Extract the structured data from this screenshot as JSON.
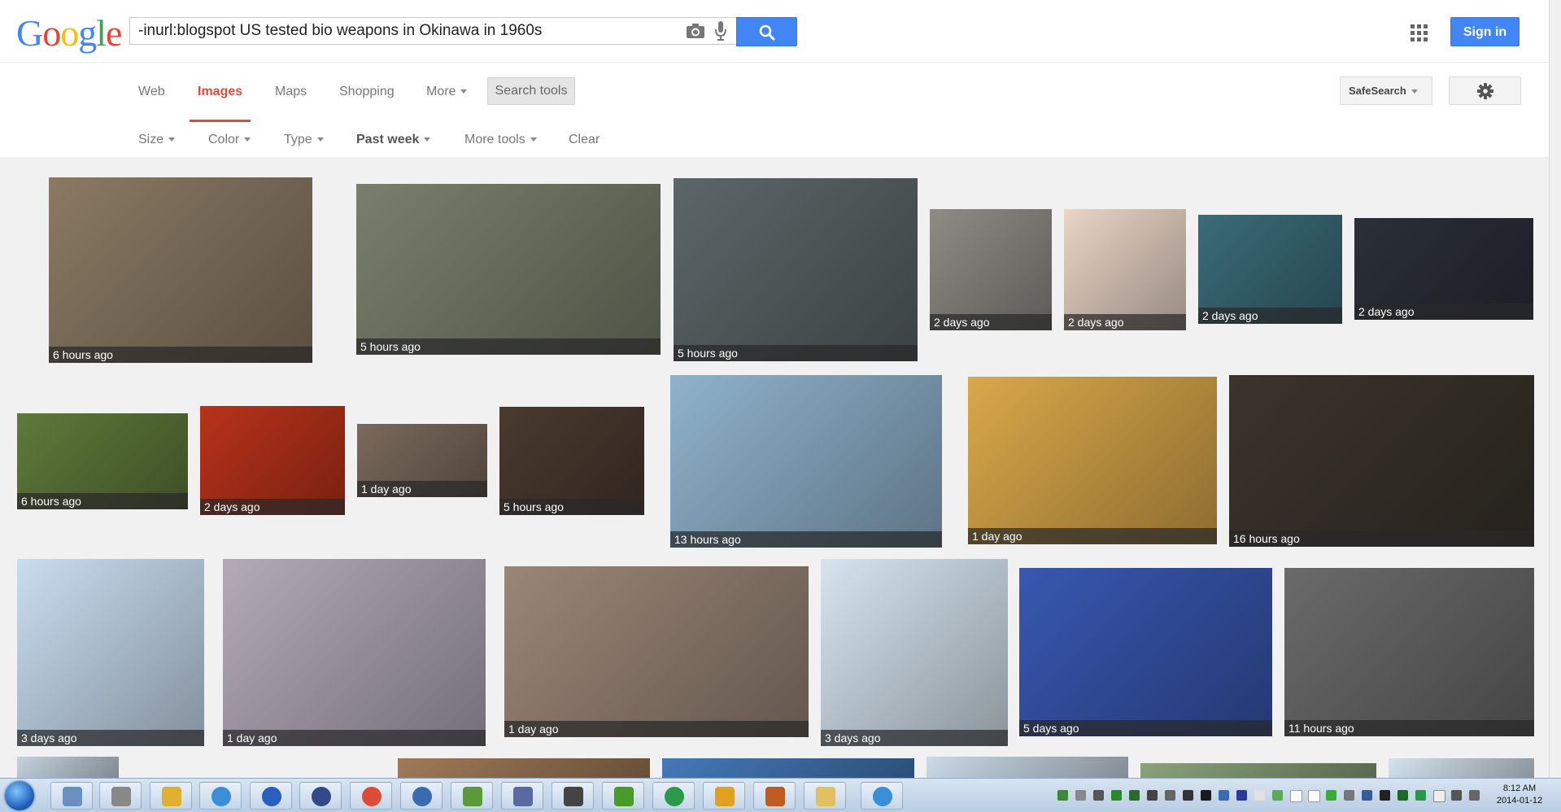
{
  "logo": {
    "letters": [
      {
        "ch": "G",
        "color": "#4285f4"
      },
      {
        "ch": "o",
        "color": "#ea4335"
      },
      {
        "ch": "o",
        "color": "#fbbc05"
      },
      {
        "ch": "g",
        "color": "#4285f4"
      },
      {
        "ch": "l",
        "color": "#34a853"
      },
      {
        "ch": "e",
        "color": "#ea4335"
      }
    ]
  },
  "search": {
    "query": "-inurl:blogspot US tested bio weapons in Okinawa in 1960s"
  },
  "header": {
    "signin_label": "Sign in"
  },
  "tabs": [
    {
      "label": "Web"
    },
    {
      "label": "Images"
    },
    {
      "label": "Maps"
    },
    {
      "label": "Shopping"
    },
    {
      "label": "More"
    }
  ],
  "search_tools_label": "Search tools",
  "safesearch_label": "SafeSearch",
  "tools": [
    {
      "label": "Size"
    },
    {
      "label": "Color"
    },
    {
      "label": "Type"
    },
    {
      "label": "Past week"
    },
    {
      "label": "More tools"
    },
    {
      "label": "Clear"
    }
  ],
  "results": [
    {
      "time": "6 hours ago",
      "color": "#8a7a64"
    },
    {
      "time": "5 hours ago",
      "color": "#7a7f6c"
    },
    {
      "time": "5 hours ago",
      "color": "#5c6668"
    },
    {
      "time": "2 days ago",
      "color": "#8e8c86"
    },
    {
      "time": "2 days ago",
      "color": "#ead5c6"
    },
    {
      "time": "2 days ago",
      "color": "#3a6c78"
    },
    {
      "time": "2 days ago",
      "color": "#2b2f38"
    },
    {
      "time": "6 hours ago",
      "color": "#5f7a3a"
    },
    {
      "time": "2 days ago",
      "color": "#b8321a"
    },
    {
      "time": "1 day ago",
      "color": "#7b6a5c"
    },
    {
      "time": "5 hours ago",
      "color": "#4a3a30"
    },
    {
      "time": "13 hours ago",
      "color": "#8fb2cc"
    },
    {
      "time": "1 day ago",
      "color": "#d9a84a"
    },
    {
      "time": "16 hours ago",
      "color": "#3b342c"
    },
    {
      "time": "3 days ago",
      "color": "#c9ddf0"
    },
    {
      "time": "1 day ago",
      "color": "#b3aab8"
    },
    {
      "time": "1 day ago",
      "color": "#9a8677"
    },
    {
      "time": "3 days ago",
      "color": "#d6e4ef"
    },
    {
      "time": "5 days ago",
      "color": "#3857b0"
    },
    {
      "time": "11 hours ago",
      "color": "#6a6a6a"
    },
    {
      "time": "",
      "color": "#c4d2dd"
    },
    {
      "time": "",
      "color": "#a07a58"
    },
    {
      "time": "",
      "color": "#4479b8"
    },
    {
      "time": "",
      "color": "#c9d9e6"
    },
    {
      "time": "",
      "color": "#8aa27a"
    },
    {
      "time": "",
      "color": "#d4e2ec"
    }
  ],
  "clock": {
    "time": "8:12 AM",
    "date": "2014-01-12"
  }
}
